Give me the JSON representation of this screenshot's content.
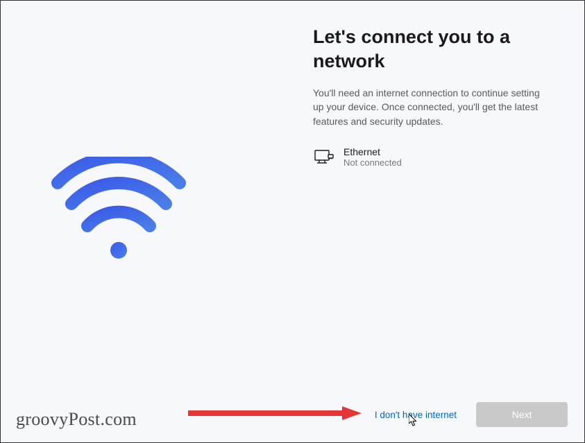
{
  "header": {
    "title": "Let's connect you to a network",
    "description": "You'll need an internet connection to continue setting up your device. Once connected, you'll get the latest features and security updates."
  },
  "network": {
    "name": "Ethernet",
    "status": "Not connected"
  },
  "footer": {
    "skip_label": "I don't have internet",
    "next_label": "Next"
  },
  "watermark": "groovyPost.com"
}
